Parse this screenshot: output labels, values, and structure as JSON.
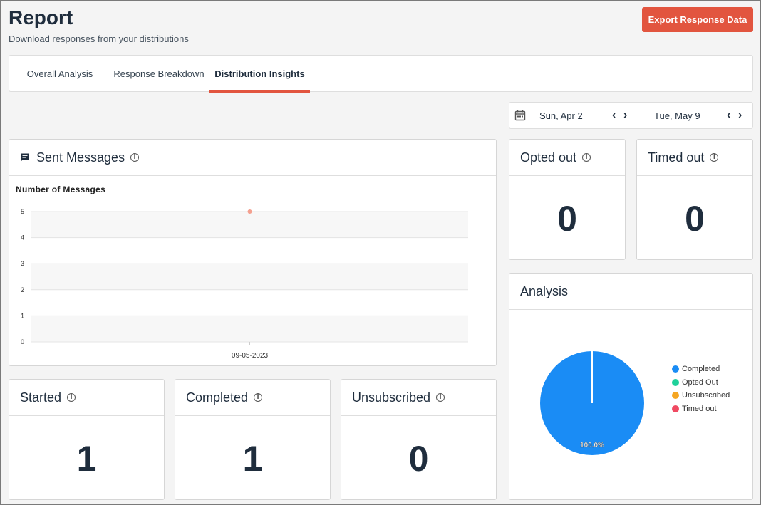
{
  "header": {
    "title": "Report",
    "subtitle": "Download responses from your distributions",
    "export_label": "Export Response Data"
  },
  "tabs": [
    {
      "label": "Overall Analysis",
      "active": false
    },
    {
      "label": "Response Breakdown",
      "active": false
    },
    {
      "label": "Distribution Insights",
      "active": true
    }
  ],
  "date_range": {
    "start": "Sun, Apr 2",
    "end": "Tue, May 9",
    "icon": "calendar-icon"
  },
  "sent_messages": {
    "title": "Sent Messages",
    "icon": "chat-icon",
    "info_icon": "info-icon",
    "chart_title": "Number of Messages"
  },
  "chart_data": {
    "type": "scatter",
    "title": "Number of Messages",
    "x": [
      "09-05-2023"
    ],
    "y": [
      5
    ],
    "ylim": [
      0,
      5
    ],
    "yticks": [
      "0",
      "1",
      "2",
      "3",
      "4",
      "5"
    ],
    "grid": true,
    "color": "#f4a08f"
  },
  "stats": {
    "opted_out": {
      "label": "Opted out",
      "value": "0"
    },
    "timed_out": {
      "label": "Timed out",
      "value": "0"
    },
    "started": {
      "label": "Started",
      "value": "1"
    },
    "completed": {
      "label": "Completed",
      "value": "1"
    },
    "unsubscribed": {
      "label": "Unsubscribed",
      "value": "0"
    }
  },
  "analysis": {
    "title": "Analysis",
    "pie_label": "100.0%",
    "legend": [
      {
        "name": "Completed",
        "color": "#1a8cf5"
      },
      {
        "name": "Opted Out",
        "color": "#1fd19a"
      },
      {
        "name": "Unsubscribed",
        "color": "#f5a623"
      },
      {
        "name": "Timed out",
        "color": "#f04a62"
      }
    ],
    "pie_data": {
      "type": "pie",
      "slices": [
        {
          "name": "Completed",
          "value": 100.0
        }
      ]
    }
  }
}
